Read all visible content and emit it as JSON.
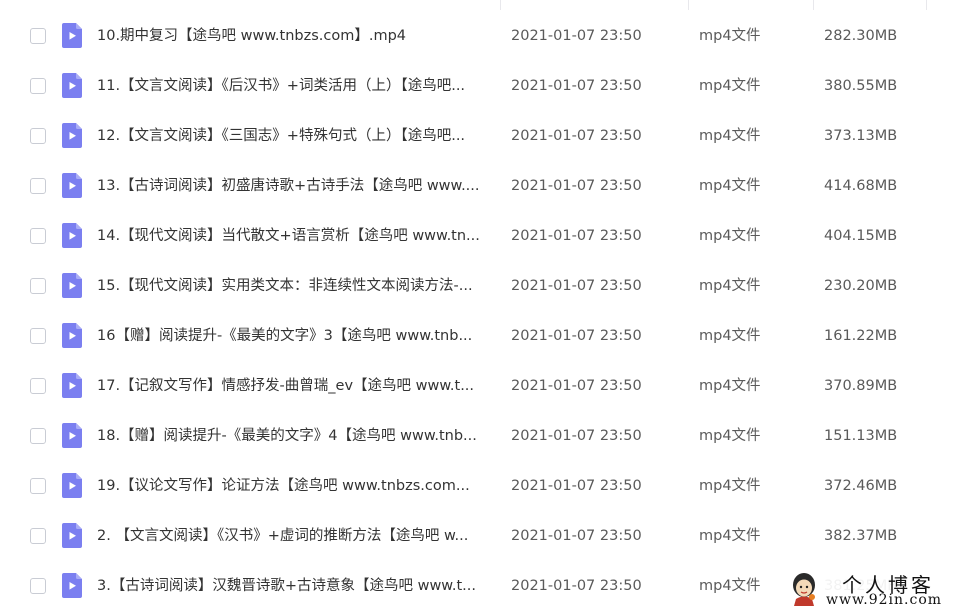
{
  "file_list": {
    "icon": "video-file-icon",
    "accent_color": "#7b7ff0",
    "rows": [
      {
        "name": "10.期中复习【途鸟吧 www.tnbzs.com】.mp4",
        "date": "2021-01-07 23:50",
        "type": "mp4文件",
        "size": "282.30MB"
      },
      {
        "name": "11.【文言文阅读】《后汉书》+词类活用（上）【途鸟吧...",
        "date": "2021-01-07 23:50",
        "type": "mp4文件",
        "size": "380.55MB"
      },
      {
        "name": "12.【文言文阅读】《三国志》+特殊句式（上）【途鸟吧...",
        "date": "2021-01-07 23:50",
        "type": "mp4文件",
        "size": "373.13MB"
      },
      {
        "name": "13.【古诗词阅读】初盛唐诗歌+古诗手法【途鸟吧 www....",
        "date": "2021-01-07 23:50",
        "type": "mp4文件",
        "size": "414.68MB"
      },
      {
        "name": "14.【现代文阅读】当代散文+语言赏析【途鸟吧 www.tn...",
        "date": "2021-01-07 23:50",
        "type": "mp4文件",
        "size": "404.15MB"
      },
      {
        "name": "15.【现代文阅读】实用类文本：非连续性文本阅读方法-...",
        "date": "2021-01-07 23:50",
        "type": "mp4文件",
        "size": "230.20MB"
      },
      {
        "name": "16【赠】阅读提升-《最美的文字》3【途鸟吧 www.tnb...",
        "date": "2021-01-07 23:50",
        "type": "mp4文件",
        "size": "161.22MB"
      },
      {
        "name": "17.【记叙文写作】情感抒发-曲曾瑞_ev【途鸟吧 www.t...",
        "date": "2021-01-07 23:50",
        "type": "mp4文件",
        "size": "370.89MB"
      },
      {
        "name": "18.【赠】阅读提升-《最美的文字》4【途鸟吧 www.tnb...",
        "date": "2021-01-07 23:50",
        "type": "mp4文件",
        "size": "151.13MB"
      },
      {
        "name": "19.【议论文写作】论证方法【途鸟吧 www.tnbzs.com...",
        "date": "2021-01-07 23:50",
        "type": "mp4文件",
        "size": "372.46MB"
      },
      {
        "name": "2. 【文言文阅读】《汉书》+虚词的推断方法【途鸟吧 w...",
        "date": "2021-01-07 23:50",
        "type": "mp4文件",
        "size": "382.37MB"
      },
      {
        "name": "3.【古诗词阅读】汉魏晋诗歌+古诗意象【途鸟吧 www.t...",
        "date": "2021-01-07 23:50",
        "type": "mp4文件",
        "size": "381.25MB"
      }
    ]
  },
  "watermark": {
    "title": "个人博客",
    "url": "www.92in.com"
  }
}
